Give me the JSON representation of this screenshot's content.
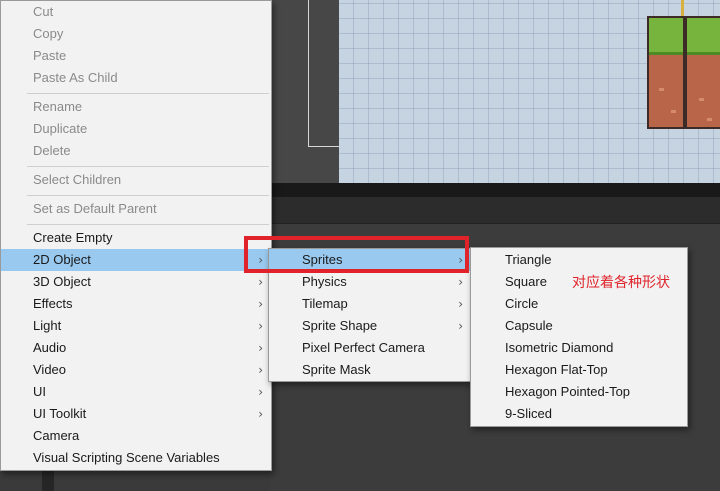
{
  "context_menu": {
    "items": [
      {
        "label": "Cut",
        "enabled": false
      },
      {
        "label": "Copy",
        "enabled": false
      },
      {
        "label": "Paste",
        "enabled": false
      },
      {
        "label": "Paste As Child",
        "enabled": false
      },
      {
        "label": "Rename",
        "enabled": false
      },
      {
        "label": "Duplicate",
        "enabled": false
      },
      {
        "label": "Delete",
        "enabled": false
      },
      {
        "label": "Select Children",
        "enabled": false
      },
      {
        "label": "Set as Default Parent",
        "enabled": false
      },
      {
        "label": "Create Empty",
        "enabled": true
      },
      {
        "label": "2D Object",
        "enabled": true,
        "submenu": true,
        "highlighted": true
      },
      {
        "label": "3D Object",
        "enabled": true,
        "submenu": true
      },
      {
        "label": "Effects",
        "enabled": true,
        "submenu": true
      },
      {
        "label": "Light",
        "enabled": true,
        "submenu": true
      },
      {
        "label": "Audio",
        "enabled": true,
        "submenu": true
      },
      {
        "label": "Video",
        "enabled": true,
        "submenu": true
      },
      {
        "label": "UI",
        "enabled": true,
        "submenu": true
      },
      {
        "label": "UI Toolkit",
        "enabled": true,
        "submenu": true
      },
      {
        "label": "Camera",
        "enabled": true
      },
      {
        "label": "Visual Scripting Scene Variables",
        "enabled": true
      }
    ]
  },
  "submenu_2d_object": {
    "items": [
      {
        "label": "Sprites",
        "submenu": true,
        "highlighted": true
      },
      {
        "label": "Physics",
        "submenu": true
      },
      {
        "label": "Tilemap",
        "submenu": true
      },
      {
        "label": "Sprite Shape",
        "submenu": true
      },
      {
        "label": "Pixel Perfect Camera"
      },
      {
        "label": "Sprite Mask"
      }
    ]
  },
  "submenu_sprites": {
    "items": [
      {
        "label": "Triangle"
      },
      {
        "label": "Square"
      },
      {
        "label": "Circle"
      },
      {
        "label": "Capsule"
      },
      {
        "label": "Isometric Diamond"
      },
      {
        "label": "Hexagon Flat-Top"
      },
      {
        "label": "Hexagon Pointed-Top"
      },
      {
        "label": "9-Sliced"
      }
    ]
  },
  "annotation": {
    "text": "对应着各种形状"
  },
  "icons": {
    "submenu_arrow": "chevron-right-icon",
    "arrow_glyph": "›"
  },
  "colors": {
    "highlight": "#99c9ef",
    "annotation_red": "#e0232b",
    "menu_bg": "#f2f2f2"
  }
}
